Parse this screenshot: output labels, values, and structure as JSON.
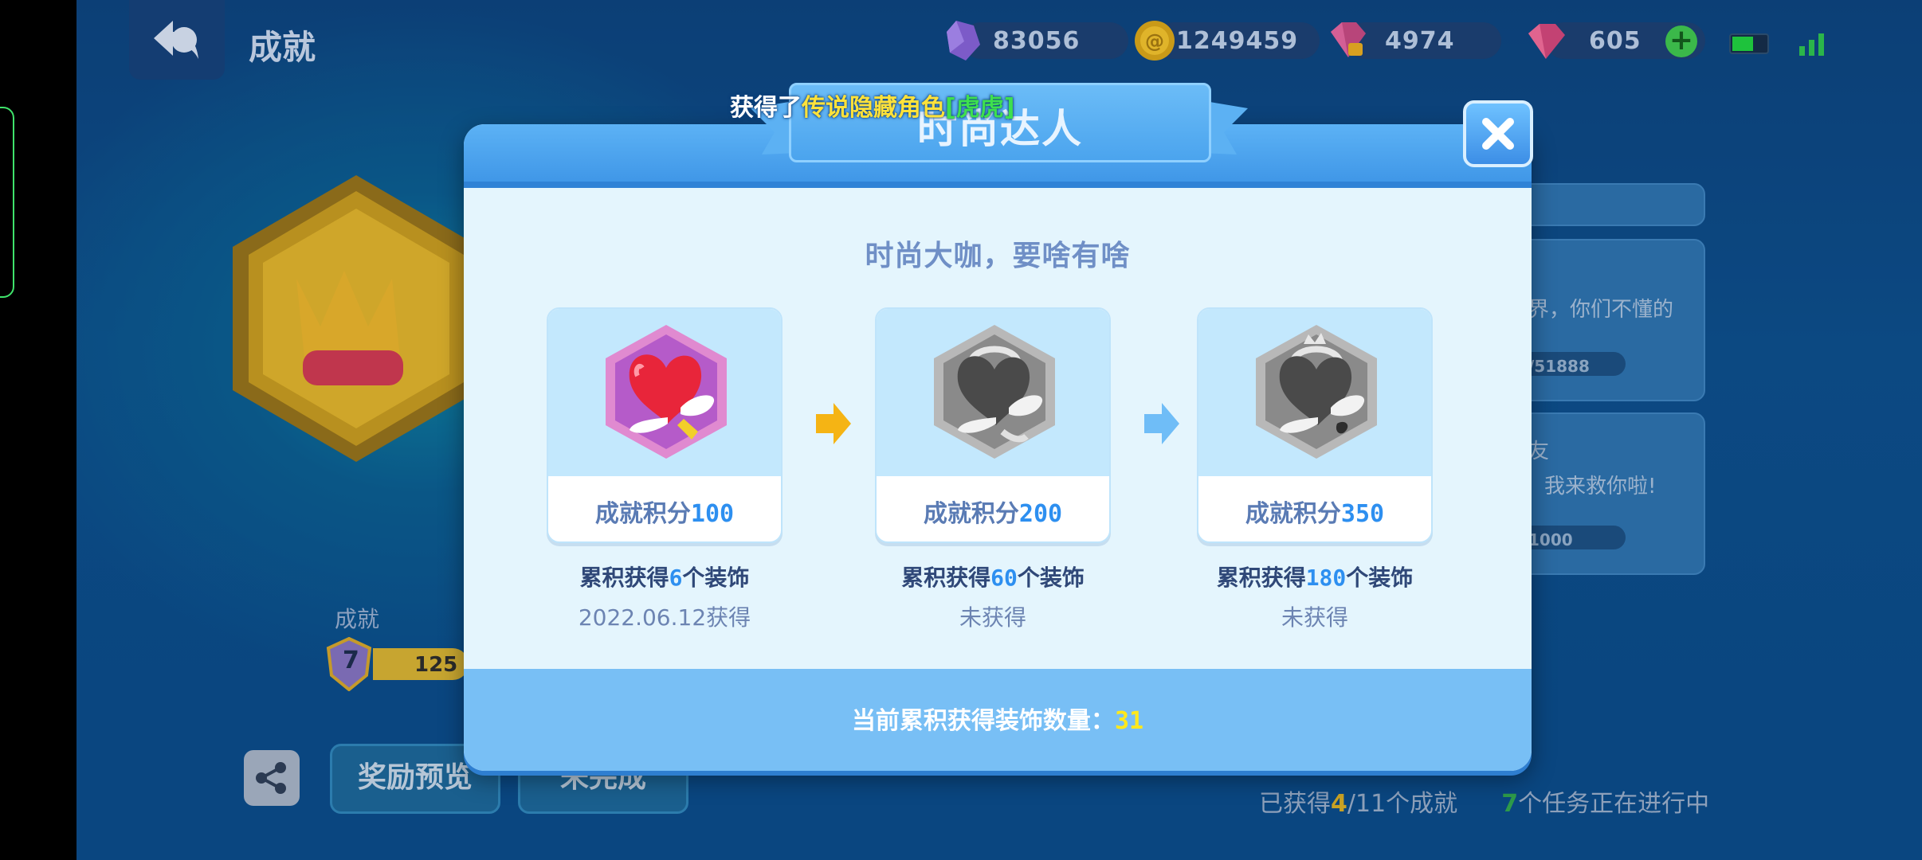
{
  "header": {
    "title": "成就",
    "resources": [
      {
        "icon": "purple-crystal-icon",
        "value": "83056"
      },
      {
        "icon": "gold-coin-icon",
        "value": "1249459"
      },
      {
        "icon": "locked-gem-icon",
        "value": "4974"
      },
      {
        "icon": "pink-gem-icon",
        "value": "605"
      }
    ]
  },
  "background": {
    "label": "成就",
    "level": "7",
    "level_value": "125",
    "reward_preview_button": "奖励预览",
    "incomplete_button": "未完成",
    "right_cards": [
      {
        "text": "界，你们不懂的",
        "progress": "/51888"
      },
      {
        "text_top": "友",
        "text": "我来救你啦!",
        "progress": "1000"
      }
    ],
    "status": {
      "earned_prefix": "已获得",
      "earned": "4",
      "sep": "/",
      "total": "11",
      "earned_suffix": "个成就",
      "tasks": "7",
      "tasks_suffix": "个任务正在进行中"
    }
  },
  "toast": {
    "prefix": "获得了",
    "highlight": "传说隐藏角色",
    "name": "[虎虎]"
  },
  "modal": {
    "title": "时尚达人",
    "subtitle": "时尚大咖，要啥有啥",
    "tiers": [
      {
        "score_label": "成就积分",
        "score": "100",
        "cond_prefix": "累积获得",
        "count": "6",
        "cond_suffix": "个装饰",
        "status": "2022.06.12获得",
        "achieved": true
      },
      {
        "score_label": "成就积分",
        "score": "200",
        "cond_prefix": "累积获得",
        "count": "60",
        "cond_suffix": "个装饰",
        "status": "未获得",
        "achieved": false
      },
      {
        "score_label": "成就积分",
        "score": "350",
        "cond_prefix": "累积获得",
        "count": "180",
        "cond_suffix": "个装饰",
        "status": "未获得",
        "achieved": false
      }
    ],
    "footer_label": "当前累积获得装饰数量：",
    "footer_value": "31"
  },
  "colors": {
    "accent_blue": "#2d8ff0",
    "footer_value": "#ffe81c",
    "arrow_gold": "#f5b414",
    "arrow_blue": "#6fbdf7"
  }
}
